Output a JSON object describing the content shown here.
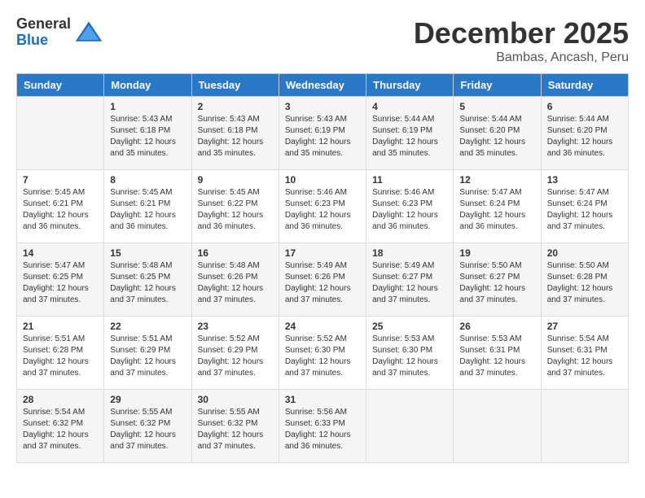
{
  "logo": {
    "general": "General",
    "blue": "Blue"
  },
  "title": "December 2025",
  "location": "Bambas, Ancash, Peru",
  "headers": [
    "Sunday",
    "Monday",
    "Tuesday",
    "Wednesday",
    "Thursday",
    "Friday",
    "Saturday"
  ],
  "weeks": [
    [
      {
        "day": "",
        "sunrise": "",
        "sunset": "",
        "daylight": ""
      },
      {
        "day": "1",
        "sunrise": "Sunrise: 5:43 AM",
        "sunset": "Sunset: 6:18 PM",
        "daylight": "Daylight: 12 hours and 35 minutes."
      },
      {
        "day": "2",
        "sunrise": "Sunrise: 5:43 AM",
        "sunset": "Sunset: 6:18 PM",
        "daylight": "Daylight: 12 hours and 35 minutes."
      },
      {
        "day": "3",
        "sunrise": "Sunrise: 5:43 AM",
        "sunset": "Sunset: 6:19 PM",
        "daylight": "Daylight: 12 hours and 35 minutes."
      },
      {
        "day": "4",
        "sunrise": "Sunrise: 5:44 AM",
        "sunset": "Sunset: 6:19 PM",
        "daylight": "Daylight: 12 hours and 35 minutes."
      },
      {
        "day": "5",
        "sunrise": "Sunrise: 5:44 AM",
        "sunset": "Sunset: 6:20 PM",
        "daylight": "Daylight: 12 hours and 35 minutes."
      },
      {
        "day": "6",
        "sunrise": "Sunrise: 5:44 AM",
        "sunset": "Sunset: 6:20 PM",
        "daylight": "Daylight: 12 hours and 36 minutes."
      }
    ],
    [
      {
        "day": "7",
        "sunrise": "Sunrise: 5:45 AM",
        "sunset": "Sunset: 6:21 PM",
        "daylight": "Daylight: 12 hours and 36 minutes."
      },
      {
        "day": "8",
        "sunrise": "Sunrise: 5:45 AM",
        "sunset": "Sunset: 6:21 PM",
        "daylight": "Daylight: 12 hours and 36 minutes."
      },
      {
        "day": "9",
        "sunrise": "Sunrise: 5:45 AM",
        "sunset": "Sunset: 6:22 PM",
        "daylight": "Daylight: 12 hours and 36 minutes."
      },
      {
        "day": "10",
        "sunrise": "Sunrise: 5:46 AM",
        "sunset": "Sunset: 6:23 PM",
        "daylight": "Daylight: 12 hours and 36 minutes."
      },
      {
        "day": "11",
        "sunrise": "Sunrise: 5:46 AM",
        "sunset": "Sunset: 6:23 PM",
        "daylight": "Daylight: 12 hours and 36 minutes."
      },
      {
        "day": "12",
        "sunrise": "Sunrise: 5:47 AM",
        "sunset": "Sunset: 6:24 PM",
        "daylight": "Daylight: 12 hours and 36 minutes."
      },
      {
        "day": "13",
        "sunrise": "Sunrise: 5:47 AM",
        "sunset": "Sunset: 6:24 PM",
        "daylight": "Daylight: 12 hours and 37 minutes."
      }
    ],
    [
      {
        "day": "14",
        "sunrise": "Sunrise: 5:47 AM",
        "sunset": "Sunset: 6:25 PM",
        "daylight": "Daylight: 12 hours and 37 minutes."
      },
      {
        "day": "15",
        "sunrise": "Sunrise: 5:48 AM",
        "sunset": "Sunset: 6:25 PM",
        "daylight": "Daylight: 12 hours and 37 minutes."
      },
      {
        "day": "16",
        "sunrise": "Sunrise: 5:48 AM",
        "sunset": "Sunset: 6:26 PM",
        "daylight": "Daylight: 12 hours and 37 minutes."
      },
      {
        "day": "17",
        "sunrise": "Sunrise: 5:49 AM",
        "sunset": "Sunset: 6:26 PM",
        "daylight": "Daylight: 12 hours and 37 minutes."
      },
      {
        "day": "18",
        "sunrise": "Sunrise: 5:49 AM",
        "sunset": "Sunset: 6:27 PM",
        "daylight": "Daylight: 12 hours and 37 minutes."
      },
      {
        "day": "19",
        "sunrise": "Sunrise: 5:50 AM",
        "sunset": "Sunset: 6:27 PM",
        "daylight": "Daylight: 12 hours and 37 minutes."
      },
      {
        "day": "20",
        "sunrise": "Sunrise: 5:50 AM",
        "sunset": "Sunset: 6:28 PM",
        "daylight": "Daylight: 12 hours and 37 minutes."
      }
    ],
    [
      {
        "day": "21",
        "sunrise": "Sunrise: 5:51 AM",
        "sunset": "Sunset: 6:28 PM",
        "daylight": "Daylight: 12 hours and 37 minutes."
      },
      {
        "day": "22",
        "sunrise": "Sunrise: 5:51 AM",
        "sunset": "Sunset: 6:29 PM",
        "daylight": "Daylight: 12 hours and 37 minutes."
      },
      {
        "day": "23",
        "sunrise": "Sunrise: 5:52 AM",
        "sunset": "Sunset: 6:29 PM",
        "daylight": "Daylight: 12 hours and 37 minutes."
      },
      {
        "day": "24",
        "sunrise": "Sunrise: 5:52 AM",
        "sunset": "Sunset: 6:30 PM",
        "daylight": "Daylight: 12 hours and 37 minutes."
      },
      {
        "day": "25",
        "sunrise": "Sunrise: 5:53 AM",
        "sunset": "Sunset: 6:30 PM",
        "daylight": "Daylight: 12 hours and 37 minutes."
      },
      {
        "day": "26",
        "sunrise": "Sunrise: 5:53 AM",
        "sunset": "Sunset: 6:31 PM",
        "daylight": "Daylight: 12 hours and 37 minutes."
      },
      {
        "day": "27",
        "sunrise": "Sunrise: 5:54 AM",
        "sunset": "Sunset: 6:31 PM",
        "daylight": "Daylight: 12 hours and 37 minutes."
      }
    ],
    [
      {
        "day": "28",
        "sunrise": "Sunrise: 5:54 AM",
        "sunset": "Sunset: 6:32 PM",
        "daylight": "Daylight: 12 hours and 37 minutes."
      },
      {
        "day": "29",
        "sunrise": "Sunrise: 5:55 AM",
        "sunset": "Sunset: 6:32 PM",
        "daylight": "Daylight: 12 hours and 37 minutes."
      },
      {
        "day": "30",
        "sunrise": "Sunrise: 5:55 AM",
        "sunset": "Sunset: 6:32 PM",
        "daylight": "Daylight: 12 hours and 37 minutes."
      },
      {
        "day": "31",
        "sunrise": "Sunrise: 5:56 AM",
        "sunset": "Sunset: 6:33 PM",
        "daylight": "Daylight: 12 hours and 36 minutes."
      },
      {
        "day": "",
        "sunrise": "",
        "sunset": "",
        "daylight": ""
      },
      {
        "day": "",
        "sunrise": "",
        "sunset": "",
        "daylight": ""
      },
      {
        "day": "",
        "sunrise": "",
        "sunset": "",
        "daylight": ""
      }
    ]
  ]
}
